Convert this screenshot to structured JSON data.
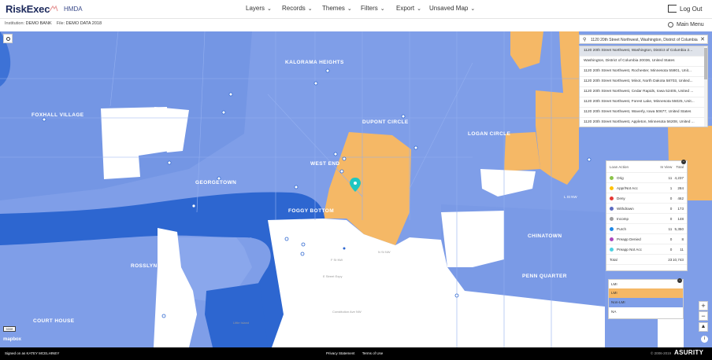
{
  "header": {
    "logo_text": "RiskExec",
    "app_name": "HMDA",
    "nav": [
      {
        "label": "Layers"
      },
      {
        "label": "Records"
      },
      {
        "label": "Themes"
      },
      {
        "label": "Filters"
      },
      {
        "label": "Export"
      },
      {
        "label": "Unsaved Map"
      }
    ],
    "logout_label": "Log Out",
    "main_menu_label": "Main Menu",
    "institution_label": "Institution:",
    "institution_value": "DEMO BANK",
    "file_label": "File:",
    "file_value": "DEMO DATA 2018"
  },
  "search": {
    "value": "1120 20th Street Northwest, Washington, District of Columbia",
    "results": [
      "1120 20th Street Northwest, Washington, District of Columbia 2...",
      "Washington, District of Columbia 20036, United States",
      "1120 20th Street Northwest, Rochester, Minnesota 55901, Unit...",
      "1120 20th Street Northwest, Minot, North Dakota 58703, United...",
      "1120 20th Street Northwest, Cedar Rapids, Iowa 52405, United ...",
      "1120 20th Street Northwest, Forest Lake, Minnesota 55025, Unit...",
      "1120 20th Street Northwest, Waverly, Iowa 50677, United States",
      "1120 20th Street Northwest, Appleton, Minnesota 56208, United ..."
    ]
  },
  "legend": {
    "headers": [
      "Loan Action",
      "In View",
      "Total"
    ],
    "rows": [
      {
        "label": "Orig",
        "color": "#8bc34a",
        "in_view": "11",
        "total": "4,237"
      },
      {
        "label": "Appr/Not Acc",
        "color": "#ffc107",
        "in_view": "1",
        "total": "284"
      },
      {
        "label": "Deny",
        "color": "#e53935",
        "in_view": "0",
        "total": "462"
      },
      {
        "label": "Withdrawn",
        "color": "#5c6bc0",
        "in_view": "0",
        "total": "173"
      },
      {
        "label": "Incomp",
        "color": "#9e9e9e",
        "in_view": "0",
        "total": "148"
      },
      {
        "label": "Purch",
        "color": "#1e88e5",
        "in_view": "11",
        "total": "5,350"
      },
      {
        "label": "Preapp Denied",
        "color": "#ab47bc",
        "in_view": "0",
        "total": "8"
      },
      {
        "label": "Preapp Not Acc",
        "color": "#4dd0e1",
        "in_view": "0",
        "total": "11"
      }
    ],
    "total_label": "Total",
    "total_in_view": "23",
    "total_total": "10,743"
  },
  "lmi": {
    "title": "LMI",
    "items": [
      {
        "label": "LMI",
        "color": "#f5b866"
      },
      {
        "label": "Non-LMI",
        "color": "#7f9ee8"
      },
      {
        "label": "NA",
        "color": "#ffffff"
      }
    ]
  },
  "map": {
    "scale_label": "500ft",
    "attribution": "mapbox",
    "neighborhoods": [
      "KALORAMA HEIGHTS",
      "DUPONT CIRCLE",
      "LOGAN CIRCLE",
      "WEST END",
      "GEORGETOWN",
      "FOGGY BOTTOM",
      "CHINATOWN",
      "PENN QUARTER",
      "ROSSLYN",
      "COURT HOUSE",
      "FOXHALL VILLAGE"
    ],
    "streets": [
      "Constitution Ave NW",
      "E Street Expy",
      "F St NW",
      "N St NW",
      "L St NW",
      "Little Island"
    ],
    "colors": {
      "water": "#2d66d0",
      "non_lmi": "#7f9ee8",
      "lmi": "#f5b866",
      "na": "#ffffff"
    }
  },
  "footer": {
    "signed_in": "Signed on as KATEY MCELHINEY",
    "links": [
      "Privacy Statement",
      "Terms of Use"
    ],
    "copyright": "© 2006-2019",
    "brand": "ASURITY"
  }
}
